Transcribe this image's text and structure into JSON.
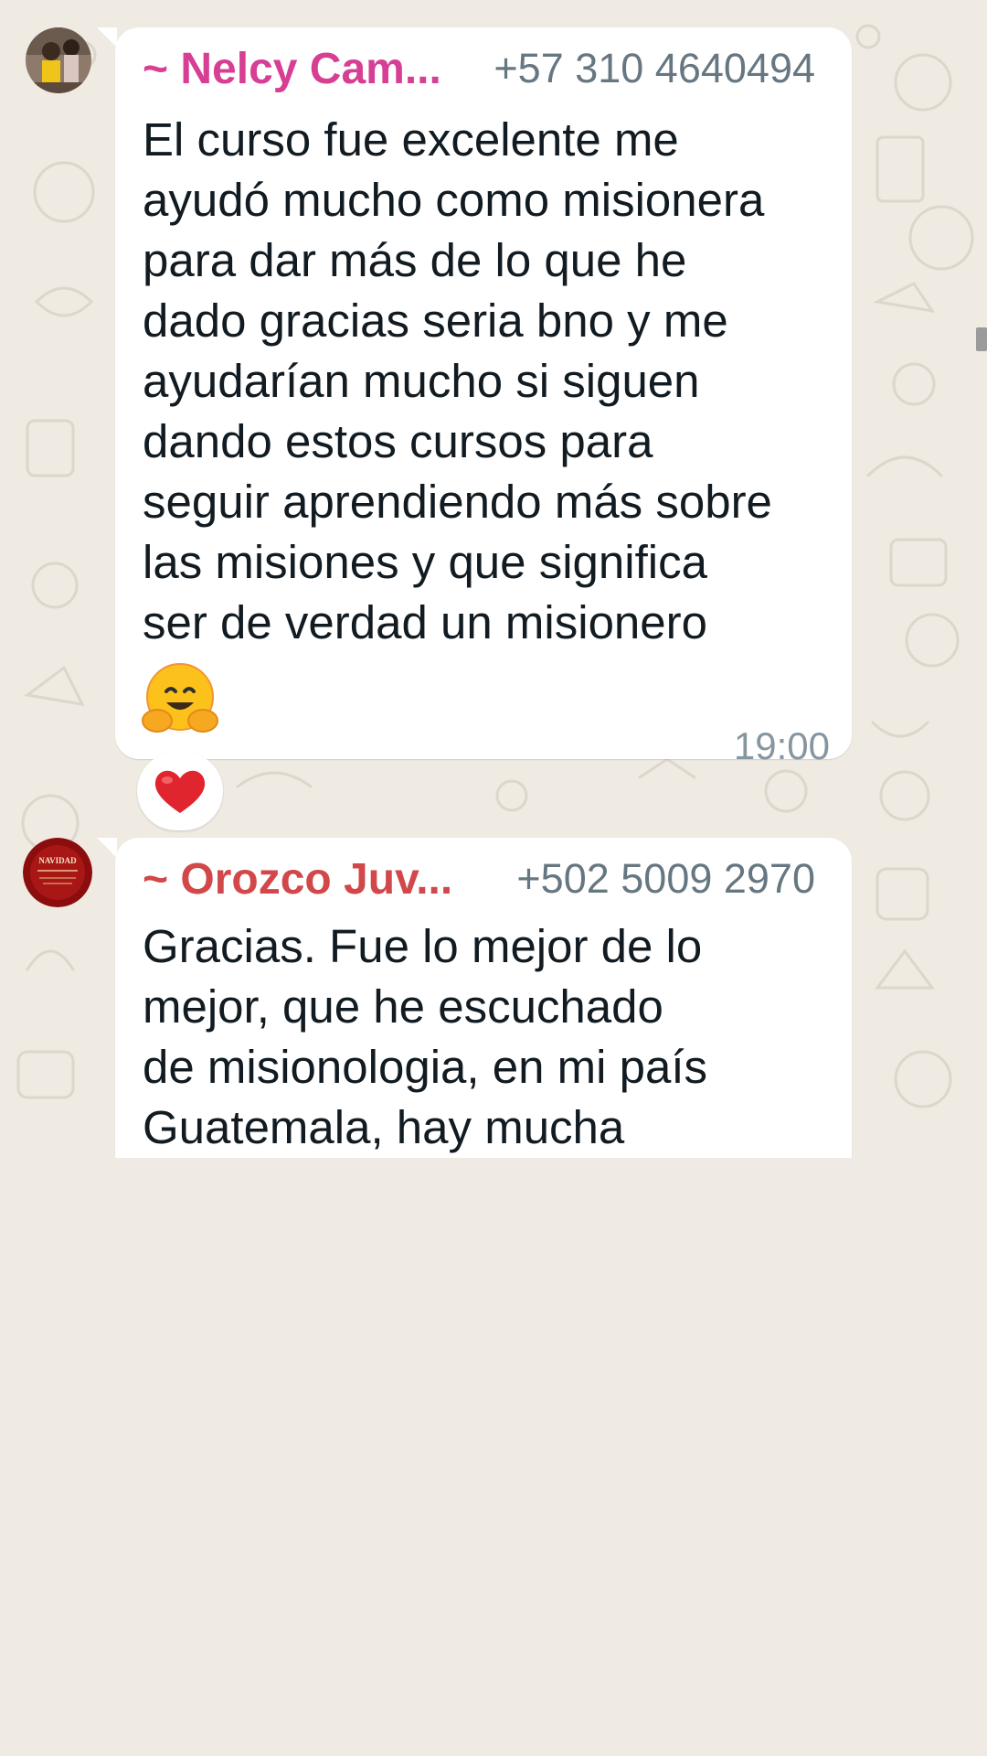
{
  "colors": {
    "chat_background": "#efeae2",
    "bubble_background": "#ffffff",
    "sender_1_name": "#d63f94",
    "sender_2_name": "#d1474a",
    "reaction_heart": "#e0252f",
    "lower_background": "#efebe4"
  },
  "messages": [
    {
      "sender_name": "~ Nelcy Cam...",
      "sender_phone": "+57 310 4640494",
      "text": "El curso fue excelente me\nayudó mucho como misionera\npara dar más de lo que he\ndado gracias seria bno y me\nayudarían mucho si siguen\ndando estos cursos para\nseguir aprendiendo más sobre\nlas misiones y que significa\nser de verdad un misionero",
      "emoji": "hugging-face-emoji",
      "time": "19:00",
      "reaction": "red-heart"
    },
    {
      "sender_name": "~ Orozco Juv...",
      "sender_phone": "+502 5009 2970",
      "text": "Gracias. Fue lo mejor de lo\nmejor, que  he escuchado\nde misionologia, en mi país\nGuatemala, hay mucha",
      "avatar_text": "NAVIDAD"
    }
  ]
}
